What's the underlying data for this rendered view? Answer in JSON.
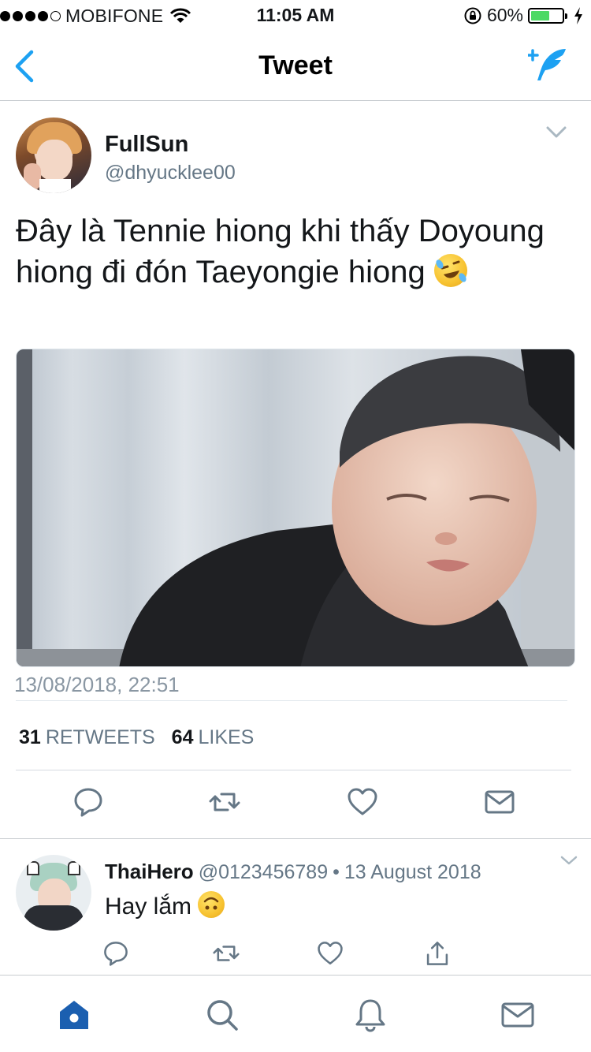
{
  "status_bar": {
    "carrier": "MOBIFONE",
    "time": "11:05 AM",
    "battery_percent": "60%",
    "battery_level": 0.6,
    "signal_bars_filled": 4,
    "signal_bars_total": 5
  },
  "nav": {
    "title": "Tweet",
    "accent_color": "#1da1f2"
  },
  "tweet": {
    "author_name": "FullSun",
    "author_handle": "@dhyucklee00",
    "text": "Đây là Tennie hiong khi thấy Doyoung hiong đi đón Taeyongie hiong",
    "emoji": "rolling-on-floor-laughing",
    "timestamp": "13/08/2018, 22:51",
    "retweets_count": "31",
    "retweets_label": "RETWEETS",
    "likes_count": "64",
    "likes_label": "LIKES"
  },
  "reply": {
    "author_name": "ThaiHero",
    "author_handle": "@0123456789",
    "separator": "•",
    "date": "13 August 2018",
    "text": "Hay lắm",
    "emoji": "upside-down-face"
  },
  "tab_bar": {
    "items": [
      "home-icon",
      "search-icon",
      "notifications-icon",
      "messages-icon"
    ],
    "active": "home-icon"
  }
}
